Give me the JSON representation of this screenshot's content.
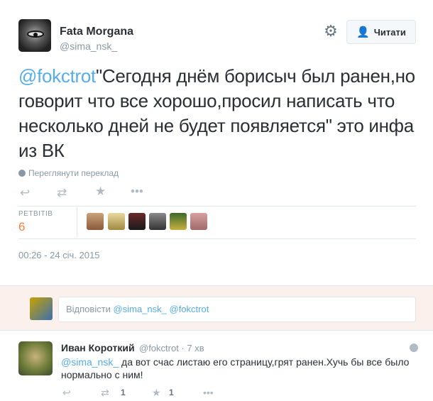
{
  "tweet": {
    "author_name": "Fata Morgana",
    "author_handle": "@sima_nsk_",
    "follow_label": "Читати",
    "mention": "@fokctrot",
    "text": "\"Сегодня днём борисыч был ранен,но говорит что все хорошо,просил написать что несколько дней не будет появляется\" это инфа из ВК",
    "translate_label": "Переглянути переклад",
    "retweets_label": "РЕТВІТІВ",
    "retweets_count": "6",
    "timestamp": "00:26 - 24 січ. 2015"
  },
  "reply_box": {
    "prefix": "Відповісти ",
    "mentions": "@sima_nsk_ @fokctrot"
  },
  "reply": {
    "author_name": "Иван Короткий",
    "author_handle": "@fokctrot · 7 хв",
    "mention": "@sima_nsk_",
    "text": " да вот счас листаю его страницу,грят ранен.Хучь бы все было нормально с ним!",
    "retweet_count": "1",
    "favorite_count": "1"
  },
  "colors": {
    "accent": "#55acee",
    "retweet_count": "#ff7f3f",
    "reply_bg": "#fbf0ec"
  },
  "retweeter_avatars": [
    "avatar-1",
    "avatar-2",
    "avatar-3",
    "avatar-4",
    "avatar-5",
    "avatar-6"
  ]
}
